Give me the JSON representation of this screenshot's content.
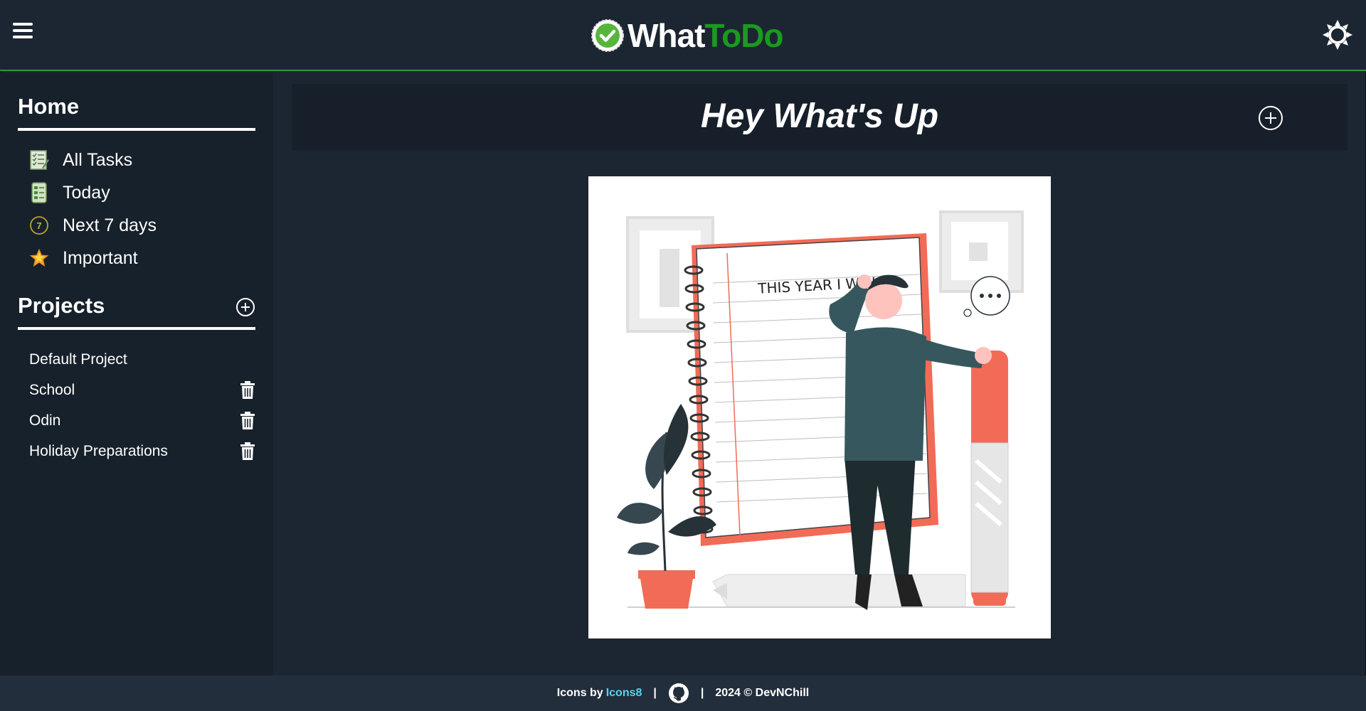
{
  "app": {
    "name_part1": "What",
    "name_part2": "ToDo",
    "brand_color": "#1a9a1f",
    "accent_border_color": "#2e9a3e"
  },
  "header": {
    "menu_icon": "hamburger-menu-icon",
    "theme_icon": "sun-icon"
  },
  "sidebar": {
    "home_heading": "Home",
    "nav_items": [
      {
        "label": "All Tasks",
        "icon": "task-list-icon"
      },
      {
        "label": "Today",
        "icon": "checklist-icon"
      },
      {
        "label": "Next 7 days",
        "icon": "seven-calendar-icon"
      },
      {
        "label": "Important",
        "icon": "star-icon"
      }
    ],
    "projects_heading": "Projects",
    "projects": [
      {
        "label": "Default Project",
        "deletable": false
      },
      {
        "label": "School",
        "deletable": true
      },
      {
        "label": "Odin",
        "deletable": true
      },
      {
        "label": "Holiday Preparations",
        "deletable": true
      }
    ]
  },
  "main": {
    "title": "Hey What's Up",
    "illustration_text": "THIS YEAR I WILL"
  },
  "footer": {
    "icons_by": "Icons by",
    "icons_link": "Icons8",
    "separator": "|",
    "copyright": "2024 © DevNChill"
  }
}
